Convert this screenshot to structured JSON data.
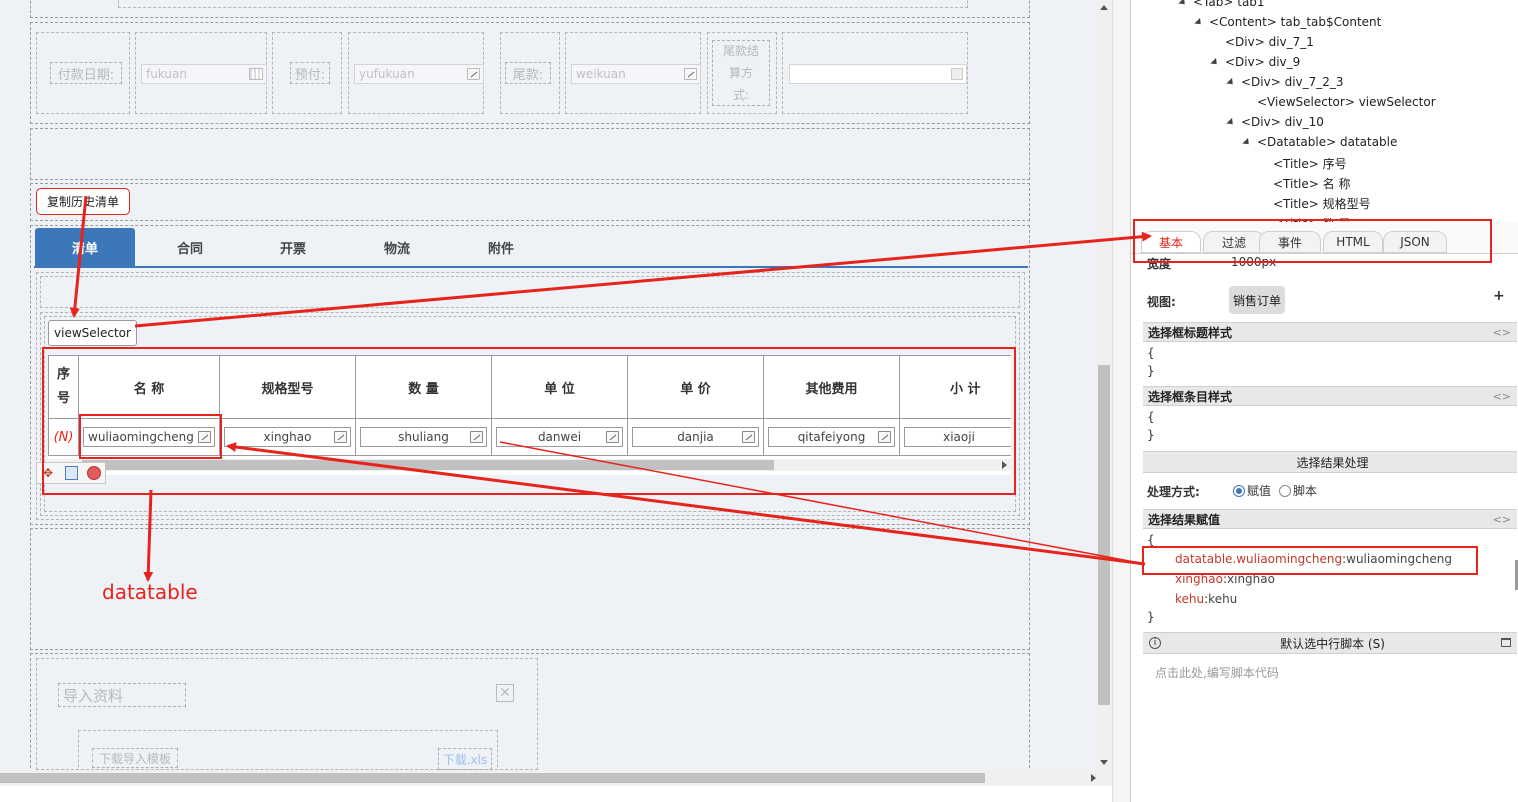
{
  "payment_row": {
    "fukuan_label": "付款日期:",
    "fukuan_value": "fukuan",
    "yufu_label": "预付:",
    "yufu_value": "yufukuan",
    "weikuan_label": "尾款:",
    "weikuan_value": "weikuan",
    "settle_label_1": "尾款结",
    "settle_label_2": "算方",
    "settle_label_3": "式:"
  },
  "copy_button": "复制历史清单",
  "tabs": [
    "清单",
    "合同",
    "开票",
    "物流",
    "附件"
  ],
  "view_selector": "viewSelector",
  "datatable": {
    "headers": [
      "序号",
      "名 称",
      "规格型号",
      "数 量",
      "单 位",
      "单 价",
      "其他费用",
      "小 计"
    ],
    "row_marker": "(N)",
    "cells": [
      "wuliaomingcheng",
      "xinghao",
      "shuliang",
      "danwei",
      "danjia",
      "qitafeiyong",
      "xiaoji"
    ]
  },
  "annotation_label": "datatable",
  "import": {
    "title": "导入资料",
    "download_label": "下载导入模板",
    "download_link": "下载.xls"
  },
  "tree": [
    {
      "text": "<Tab> tab1",
      "indent": 0
    },
    {
      "text": "<Content> tab_tab$Content",
      "indent": 1
    },
    {
      "text": "<Div> div_7_1",
      "indent": 2
    },
    {
      "text": "<Div> div_9",
      "indent": 2
    },
    {
      "text": "<Div> div_7_2_3",
      "indent": 3
    },
    {
      "text": "<ViewSelector> viewSelector",
      "indent": 4
    },
    {
      "text": "<Div> div_10",
      "indent": 3
    },
    {
      "text": "<Datatable> datatable",
      "indent": 4
    },
    {
      "text": "<Title> 序号",
      "indent": 5
    },
    {
      "text": "<Title> 名 称",
      "indent": 5
    },
    {
      "text": "<Title> 规格型号",
      "indent": 5
    },
    {
      "text": "<Title> 数 量",
      "indent": 5
    }
  ],
  "prop_tabs": [
    "基本",
    "过滤",
    "事件",
    "HTML",
    "JSON"
  ],
  "props": {
    "width_label": "宽度",
    "width_value": "1000px",
    "view_label": "视图:",
    "view_value": "销售订单",
    "add_symbol": "+",
    "title_style_head": "选择框标题样式",
    "item_style_head": "选择框条目样式",
    "brace_open": "{",
    "brace_close": "}",
    "result_handle_head": "选择结果处理",
    "mode_label": "处理方式:",
    "mode_assign": "赋值",
    "mode_script": "脚本",
    "assign_head": "选择结果赋值",
    "assign_lines": [
      {
        "key": "datatable.wuliaomingcheng",
        "value": "wuliaomingcheng"
      },
      {
        "key": "xinghao",
        "value": "xinghao"
      },
      {
        "key": "kehu",
        "value": "kehu"
      }
    ],
    "default_script_head": "默认选中行脚本 (S)",
    "script_placeholder": "点击此处,编写脚本代码",
    "collapse_symbol": "<>"
  },
  "colors": {
    "accent": "#3c78b9",
    "annotation": "#e8231b",
    "key_text": "#c0392b"
  }
}
